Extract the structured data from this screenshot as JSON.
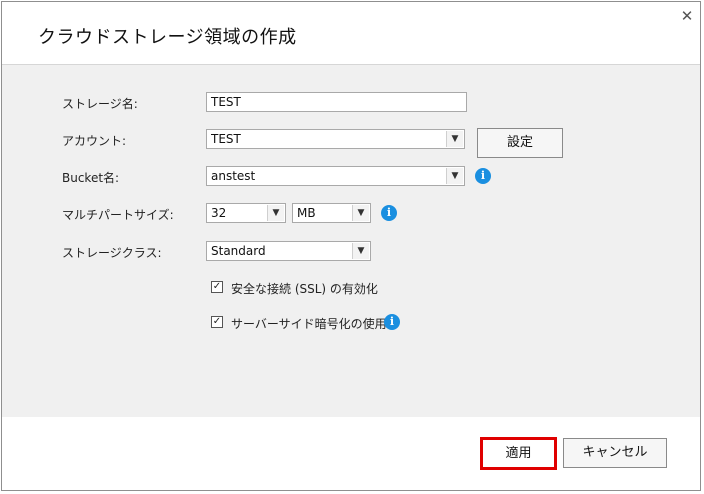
{
  "dialog": {
    "title": "クラウドストレージ領域の作成",
    "close_glyph": "✕"
  },
  "form": {
    "storage_name": {
      "label": "ストレージ名:",
      "value": "TEST"
    },
    "account": {
      "label": "アカウント:",
      "value": "TEST",
      "settings_button": "設定"
    },
    "bucket": {
      "label": "Bucket名:",
      "value": "anstest"
    },
    "multipart": {
      "label": "マルチパートサイズ:",
      "size": "32",
      "unit": "MB"
    },
    "storage_class": {
      "label": "ストレージクラス:",
      "value": "Standard"
    },
    "ssl": {
      "label": "安全な接続 (SSL) の有効化",
      "checked": true
    },
    "sse": {
      "label": "サーバーサイド暗号化の使用",
      "checked": true
    }
  },
  "icons": {
    "info": "info-icon",
    "dropdown": "chevron-down-icon",
    "check": "✓",
    "info_glyph": "i",
    "arrow_glyph": "▼"
  },
  "footer": {
    "apply": "適用",
    "cancel": "キャンセル"
  },
  "colors": {
    "highlight": "#e00000",
    "info": "#1a8fe0",
    "panel": "#f0f0f0"
  }
}
